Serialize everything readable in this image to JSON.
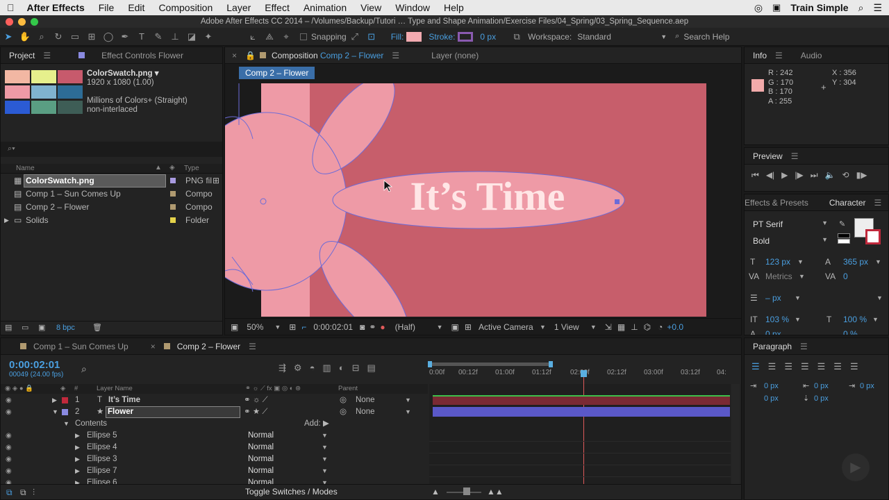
{
  "menubar": {
    "app": "After Effects",
    "items": [
      "File",
      "Edit",
      "Composition",
      "Layer",
      "Effect",
      "Animation",
      "View",
      "Window",
      "Help"
    ],
    "train": "Train Simple"
  },
  "window_title": "Adobe After Effects CC 2014 – /Volumes/Backup/Tutori … Type and Shape Animation/Exercise Files/04_Spring/03_Spring_Sequence.aep",
  "toolbar": {
    "snapping": "Snapping",
    "fill": "Fill:",
    "fill_color": "#f2aab0",
    "stroke": "Stroke:",
    "stroke_px": "0 px",
    "workspace_label": "Workspace:",
    "workspace": "Standard",
    "search": "Search Help"
  },
  "project": {
    "tab": "Project",
    "effect_tab": "Effect Controls Flower",
    "file_name": "ColorSwatch.png ▾",
    "file_dims": "1920 x 1080 (1.00)",
    "file_colors": "Millions of Colors+ (Straight)",
    "file_interlace": "non-interlaced",
    "search_placeholder": "⌕▾",
    "col_name": "Name",
    "col_type": "Type",
    "bpc": "8 bpc",
    "items": [
      {
        "name": "ColorSwatch.png",
        "type": "PNG fil",
        "color": "#a89ae0"
      },
      {
        "name": "Comp 1 – Sun Comes Up",
        "type": "Compo",
        "color": "#b09a70"
      },
      {
        "name": "Comp 2 – Flower",
        "type": "Compo",
        "color": "#b09a70"
      },
      {
        "name": "Solids",
        "type": "Folder",
        "color": "#e4d24a"
      }
    ],
    "swatches": [
      "#f2b7a3",
      "#e6f08c",
      "#c75a6c",
      "#ee9aa6",
      "#7fb3cf",
      "#2d6c96",
      "#2b5bd4",
      "#5a9e83",
      "#3e5d56"
    ]
  },
  "comp": {
    "tab_label": "Composition",
    "tab_name": "Comp 2 – Flower",
    "layer_tab": "Layer (none)",
    "crumb": "Comp 2 – Flower",
    "text": "It’s Time",
    "zoom": "50%",
    "timecode": "0:00:02:01",
    "res": "(Half)",
    "camera": "Active Camera",
    "views": "1 View",
    "exposure": "+0.0",
    "bg": "#c75e6b",
    "petal": "#ee9aa6"
  },
  "info": {
    "tab": "Info",
    "audio_tab": "Audio",
    "r": "R : 242",
    "g": "G : 170",
    "b": "B : 170",
    "a": "A : 255",
    "x": "X : 356",
    "y": "Y : 304",
    "color": "#f2aaaa"
  },
  "preview": {
    "tab": "Preview"
  },
  "character": {
    "effects_tab": "Effects & Presets",
    "tab": "Character",
    "font": "PT Serif",
    "style": "Bold",
    "size": "123 px",
    "leading": "365 px",
    "kerning": "Metrics",
    "tracking": "0",
    "stroke_w": "– px",
    "vscale": "103 %",
    "hscale": "100 %",
    "baseline": "0 px",
    "tsume": "0 %"
  },
  "paragraph": {
    "tab": "Paragraph",
    "v1": "0 px",
    "v2": "0 px",
    "v3": "0 px",
    "v4": "0 px",
    "v5": "0 px"
  },
  "timeline": {
    "tab1": "Comp 1 – Sun Comes Up",
    "tab2": "Comp 2 – Flower",
    "timecode": "0:00:02:01",
    "frames": "00049 (24.00 fps)",
    "col_layer": "Layer Name",
    "col_parent": "Parent",
    "col_num": "#",
    "toggle": "Toggle Switches / Modes",
    "add": "Add:",
    "contents": "Contents",
    "ruler": [
      "0:00f",
      "00:12f",
      "01:00f",
      "01:12f",
      "02:00f",
      "02:12f",
      "03:00f",
      "03:12f",
      "04:"
    ],
    "layers": [
      {
        "num": "1",
        "name": "It’s Time",
        "parent": "None",
        "color": "#c0293c"
      },
      {
        "num": "2",
        "name": "Flower",
        "parent": "None",
        "color": "#8a8ae0"
      }
    ],
    "ellipses": [
      {
        "name": "Ellipse 5",
        "mode": "Normal"
      },
      {
        "name": "Ellipse 4",
        "mode": "Normal"
      },
      {
        "name": "Ellipse 3",
        "mode": "Normal"
      },
      {
        "name": "Ellipse 7",
        "mode": "Normal"
      },
      {
        "name": "Ellipse 6",
        "mode": "Normal"
      }
    ]
  }
}
